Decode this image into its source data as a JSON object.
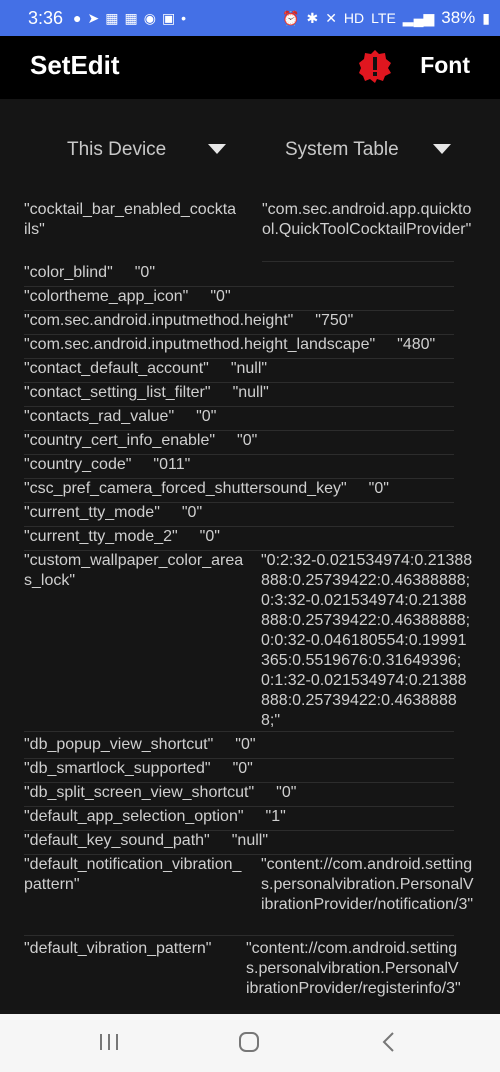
{
  "status": {
    "time": "3:36",
    "battery": "38%",
    "net_hd": "HD",
    "net_lte": "LTE"
  },
  "app": {
    "title": "SetEdit",
    "font_label": "Font"
  },
  "spinners": {
    "device": "This Device",
    "table": "System Table"
  },
  "rows": [
    {
      "k": "\"cocktail_bar_enabled_cocktails\"",
      "v": "\"com.sec.android.app.quicktool.QuickToolCocktailProvider\""
    },
    {
      "k": "\"color_blind\"",
      "v": "\"0\""
    },
    {
      "k": "\"colortheme_app_icon\"",
      "v": "\"0\""
    },
    {
      "k": "\"com.sec.android.inputmethod.height\"",
      "v": "\"750\""
    },
    {
      "k": "\"com.sec.android.inputmethod.height_landscape\"",
      "v": "\"480\""
    },
    {
      "k": "\"contact_default_account\"",
      "v": "\"null\""
    },
    {
      "k": "\"contact_setting_list_filter\"",
      "v": "\"null\""
    },
    {
      "k": "\"contacts_rad_value\"",
      "v": "\"0\""
    },
    {
      "k": "\"country_cert_info_enable\"",
      "v": "\"0\""
    },
    {
      "k": "\"country_code\"",
      "v": "\"011\""
    },
    {
      "k": "\"csc_pref_camera_forced_shuttersound_key\"",
      "v": "\"0\""
    },
    {
      "k": "\"current_tty_mode\"",
      "v": "\"0\""
    },
    {
      "k": "\"current_tty_mode_2\"",
      "v": "\"0\""
    },
    {
      "k": "\"custom_wallpaper_color_areas_lock\"",
      "v": "\"0:2:32-0.021534974:0.21388888:0.25739422:0.46388888;0:3:32-0.021534974:0.21388888:0.25739422:0.46388888;0:0:32-0.046180554:0.19991365:0.5519676:0.31649396;0:1:32-0.021534974:0.21388888:0.25739422:0.46388888;\""
    },
    {
      "k": "\"db_popup_view_shortcut\"",
      "v": "\"0\""
    },
    {
      "k": "\"db_smartlock_supported\"",
      "v": "\"0\""
    },
    {
      "k": "\"db_split_screen_view_shortcut\"",
      "v": "\"0\""
    },
    {
      "k": "\"default_app_selection_option\"",
      "v": "\"1\""
    },
    {
      "k": "\"default_key_sound_path\"",
      "v": "\"null\""
    },
    {
      "k": "\"default_notification_vibration_pattern\"",
      "v": "\"content://com.android.settings.personalvibration.PersonalVibrationProvider/notification/3\""
    },
    {
      "k": "\"default_vibration_pattern\"",
      "v": "\"content://com.android.settings.personalvibration.PersonalVibrationProvider/registerinfo/3\""
    }
  ]
}
